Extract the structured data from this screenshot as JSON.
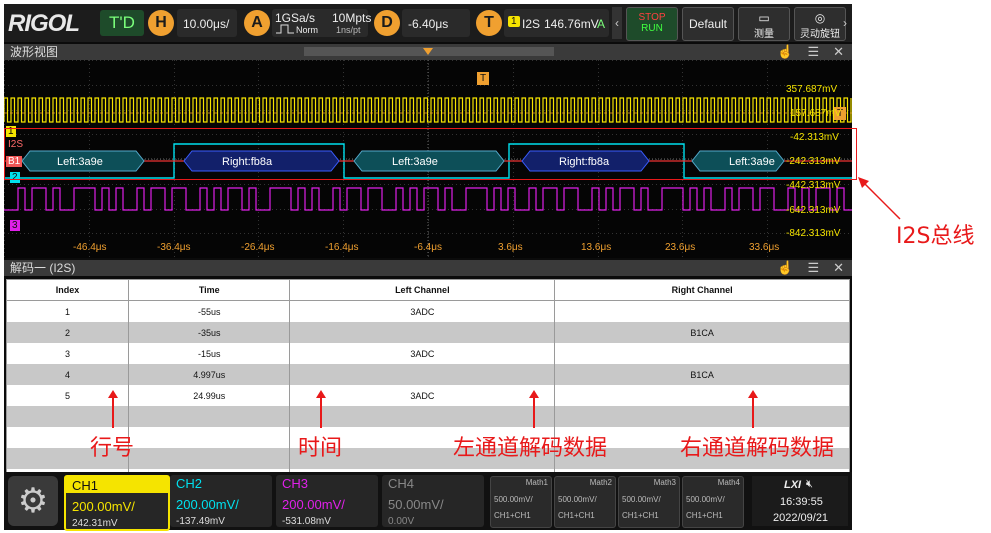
{
  "topbar": {
    "logo": "RIGOL",
    "run_mode": "T'D",
    "h_label": "H",
    "timebase": "10.00μs/",
    "a_label": "A",
    "sample_rate": "1GSa/s",
    "acq_mode": "Norm",
    "mem_depth": "10Mpts",
    "sample_interval": "1ns/pt",
    "d_label": "D",
    "delay": "-6.40μs",
    "t_label": "T",
    "trigger_source": "1",
    "trigger_type": "I2S",
    "trigger_level": "146.76mV",
    "trigger_status": "A",
    "stop_run_1": "STOP",
    "stop_run_2": "RUN",
    "default_label": "Default",
    "measure_label": "测量",
    "knob_label": "灵动旋钮"
  },
  "waveform": {
    "title": "波形视图",
    "i2s_label": "I2S",
    "bus_label": "B1",
    "ch1_marker": "1",
    "ch2_marker": "2",
    "ch3_marker": "3",
    "trigger_marker": "T",
    "decode_segments": [
      "Left:3a9e",
      "Right:fb8a",
      "Left:3a9e",
      "Right:fb8a",
      "Left:3a9e"
    ],
    "voltage_labels": [
      "357.687mV",
      "157.687mV",
      "-42.313mV",
      "-242.313mV",
      "-442.313mV",
      "-642.313mV",
      "-842.313mV"
    ],
    "time_labels": [
      "-46.4μs",
      "-36.4μs",
      "-26.4μs",
      "-16.4μs",
      "-6.4μs",
      "3.6μs",
      "13.6μs",
      "23.6μs",
      "33.6μs"
    ]
  },
  "decode": {
    "title": "解码一 (I2S)",
    "columns": [
      "Index",
      "Time",
      "Left Channel",
      "Right Channel"
    ],
    "rows": [
      [
        "1",
        "-55us",
        "3ADC",
        ""
      ],
      [
        "2",
        "-35us",
        "",
        "B1CA"
      ],
      [
        "3",
        "-15us",
        "3ADC",
        ""
      ],
      [
        "4",
        "4.997us",
        "",
        "B1CA"
      ],
      [
        "5",
        "24.99us",
        "3ADC",
        ""
      ]
    ]
  },
  "channels": [
    {
      "name": "CH1",
      "scale": "200.00mV/",
      "offset": "242.31mV",
      "color": "#f5e400"
    },
    {
      "name": "CH2",
      "scale": "200.00mV/",
      "offset": "-137.49mV",
      "color": "#00e0ee"
    },
    {
      "name": "CH3",
      "scale": "200.00mV/",
      "offset": "-531.08mV",
      "color": "#e020ea"
    },
    {
      "name": "CH4",
      "scale": "50.00mV/",
      "offset": "0.00V",
      "color": "#777777"
    }
  ],
  "math": [
    {
      "name": "Math1",
      "scale": "500.00mV/",
      "expr": "CH1+CH1"
    },
    {
      "name": "Math2",
      "scale": "500.00mV/",
      "expr": "CH1+CH1"
    },
    {
      "name": "Math3",
      "scale": "500.00mV/",
      "expr": "CH1+CH1"
    },
    {
      "name": "Math4",
      "scale": "500.00mV/",
      "expr": "CH1+CH1"
    }
  ],
  "status": {
    "lxi": "LXI",
    "time": "16:39:55",
    "date": "2022/09/21"
  },
  "annotations": {
    "bus": "I2S总线",
    "row_no": "行号",
    "time": "时间",
    "left": "左通道解码数据",
    "right": "右通道解码数据"
  }
}
